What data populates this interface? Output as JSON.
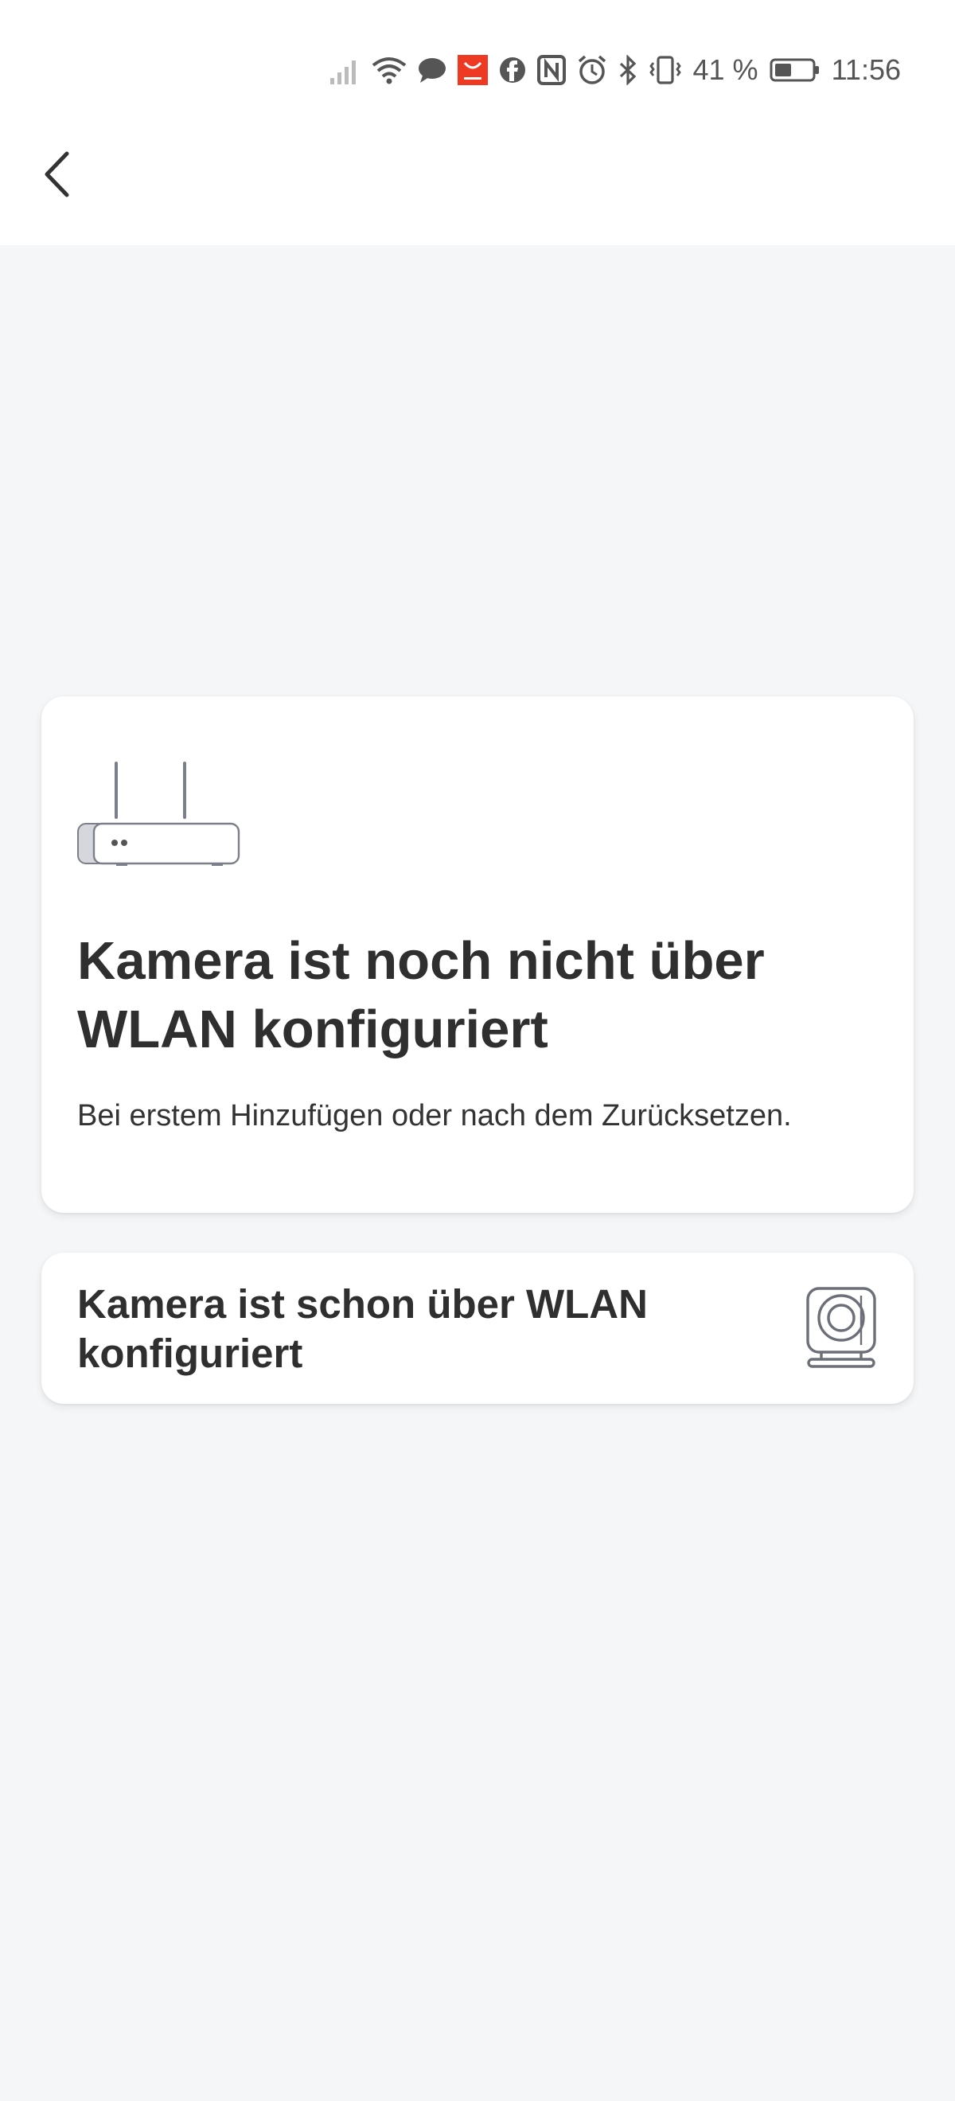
{
  "status_bar": {
    "battery_percent": "41 %",
    "time": "11:56",
    "icons": [
      "signal-icon",
      "wifi-icon",
      "chat-bubble-icon",
      "aliexpress-icon",
      "facebook-icon",
      "nfc-icon",
      "alarm-icon",
      "bluetooth-icon",
      "vibrate-icon",
      "battery-icon"
    ],
    "accent_app_color": "#ee3a23"
  },
  "header": {
    "back_icon": "chevron-left-icon"
  },
  "options": [
    {
      "title": "Kamera ist noch nicht über WLAN konfiguriert",
      "description": "Bei erstem Hinzufügen oder nach dem Zurücksetzen.",
      "icon": "router-icon"
    },
    {
      "title": "Kamera ist schon über WLAN konfiguriert",
      "icon": "camera-icon"
    }
  ]
}
